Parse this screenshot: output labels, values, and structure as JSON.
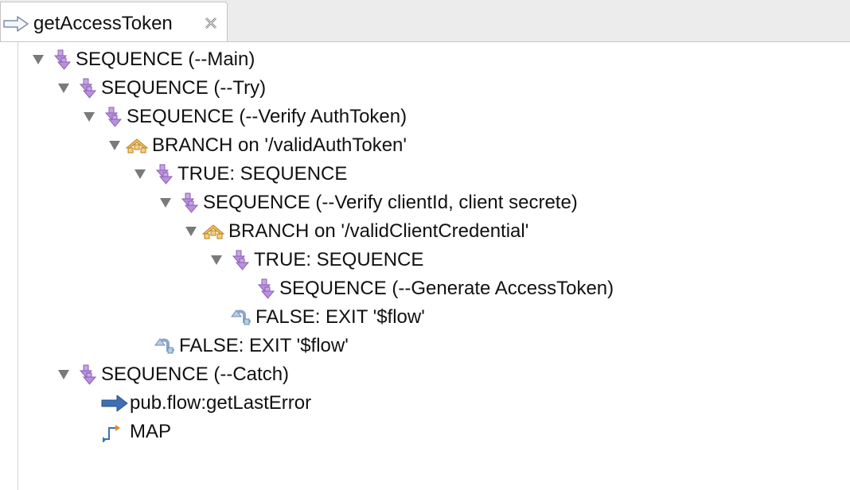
{
  "tab": {
    "title": "getAccessToken",
    "icon": "flow-arrow-icon",
    "close_icon": "close-icon"
  },
  "tree": [
    {
      "label": "SEQUENCE (--Main)",
      "icon": "sequence-icon",
      "expanded": true
    },
    {
      "label": "SEQUENCE (--Try)",
      "icon": "sequence-icon",
      "expanded": true
    },
    {
      "label": "SEQUENCE (--Verify AuthToken)",
      "icon": "sequence-icon",
      "expanded": true
    },
    {
      "label": "BRANCH on '/validAuthToken'",
      "icon": "branch-icon",
      "expanded": true
    },
    {
      "label": "TRUE: SEQUENCE",
      "icon": "sequence-icon",
      "expanded": true
    },
    {
      "label": "SEQUENCE (--Verify clientId, client secrete)",
      "icon": "sequence-icon",
      "expanded": true
    },
    {
      "label": "BRANCH on '/validClientCredential'",
      "icon": "branch-icon",
      "expanded": true
    },
    {
      "label": "TRUE: SEQUENCE",
      "icon": "sequence-icon",
      "expanded": true
    },
    {
      "label": "SEQUENCE (--Generate AccessToken)",
      "icon": "sequence-icon",
      "expanded": false
    },
    {
      "label": "FALSE: EXIT '$flow'",
      "icon": "exit-icon",
      "expanded": false
    },
    {
      "label": "FALSE: EXIT '$flow'",
      "icon": "exit-icon",
      "expanded": false
    },
    {
      "label": "SEQUENCE (--Catch)",
      "icon": "sequence-icon",
      "expanded": true
    },
    {
      "label": "pub.flow:getLastError",
      "icon": "invoke-icon",
      "expanded": false
    },
    {
      "label": "MAP",
      "icon": "map-icon",
      "expanded": false
    }
  ],
  "colors": {
    "sequence": "#b08ad0",
    "branch": "#e0a030",
    "exit": "#6a8fb8",
    "invoke": "#3e6fb4",
    "map": "#e08a2a"
  }
}
